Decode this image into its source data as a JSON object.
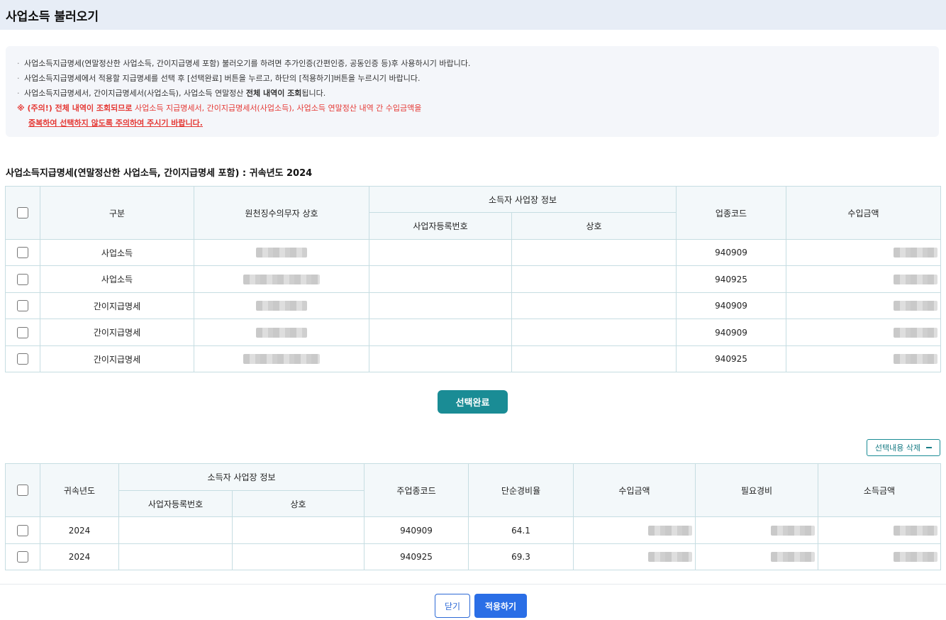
{
  "header": {
    "title": "사업소득 불러오기"
  },
  "notice": {
    "line1": "사업소득지급명세(연말정산한 사업소득, 간이지급명세 포함) 불러오기를 하려면 추가인증(간편인증, 공동인증 등)후 사용하시기 바랍니다.",
    "line2": "사업소득지급명세에서 적용할 지급명세를 선택 후 [선택완료] 버튼을 누르고, 하단의 [적용하기]버튼을 누르시기 바랍니다.",
    "line3_pre": "사업소득지급명세서, 간이지급명세서(사업소득), 사업소득 연말정산 ",
    "line3_bold": "전체 내역이 조회",
    "line3_post": "됩니다.",
    "warn_bold": "※ (주의!) 전체 내역이 조회되므로",
    "warn_rest": " 사업소득 지급명세서, 간이지급명세서(사업소득), 사업소득 연말정산 내역 간 수입금액을",
    "warn_line2": "중복하여 선택하지 않도록 주의하여 주시기 바랍니다."
  },
  "section_title": "사업소득지급명세(연말정산한 사업소득, 간이지급명세 포함) : 귀속년도 2024",
  "upper_table": {
    "headers": {
      "type": "구분",
      "withholder_name": "원천징수의무자 상호",
      "earner_info": "소득자 사업장 정보",
      "biz_reg_no": "사업자등록번호",
      "biz_name": "상호",
      "industry_code": "업종코드",
      "income_amount": "수입금액"
    },
    "rows": [
      {
        "type": "사업소득",
        "industry_code": "940909"
      },
      {
        "type": "사업소득",
        "industry_code": "940925"
      },
      {
        "type": "간이지급명세",
        "industry_code": "940909"
      },
      {
        "type": "간이지급명세",
        "industry_code": "940909"
      },
      {
        "type": "간이지급명세",
        "industry_code": "940925"
      }
    ]
  },
  "select_done_button": "선택완료",
  "delete_selected_button": "선택내용 삭제",
  "lower_table": {
    "headers": {
      "year": "귀속년도",
      "earner_info": "소득자 사업장 정보",
      "biz_reg_no": "사업자등록번호",
      "biz_name": "상호",
      "main_industry_code": "주업종코드",
      "simple_expense_rate": "단순경비율",
      "income_amount": "수입금액",
      "necessary_expense": "필요경비",
      "income": "소득금액"
    },
    "rows": [
      {
        "year": "2024",
        "main_industry_code": "940909",
        "simple_expense_rate": "64.1"
      },
      {
        "year": "2024",
        "main_industry_code": "940925",
        "simple_expense_rate": "69.3"
      }
    ]
  },
  "footer": {
    "close_button": "닫기",
    "apply_button": "적용하기"
  }
}
